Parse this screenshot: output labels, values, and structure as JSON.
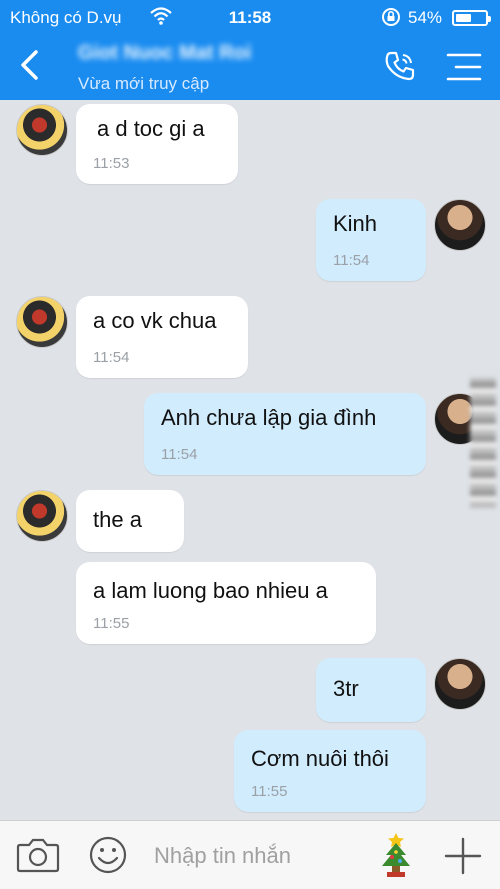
{
  "status_bar": {
    "carrier": "Không có D.vụ",
    "time": "11:58",
    "battery_percent": "54%",
    "battery_level": 0.54
  },
  "header": {
    "contact_name": "Giot Nuoc Mat Roi",
    "contact_status": "Vừa mới truy cập",
    "accent_color": "#1a8cf0"
  },
  "messages": [
    {
      "side": "in",
      "text": "a d toc gi a",
      "time": "11:53"
    },
    {
      "side": "out",
      "text": "Kinh",
      "time": "11:54"
    },
    {
      "side": "in",
      "text": "a co vk chua",
      "time": "11:54"
    },
    {
      "side": "out",
      "text": "Anh chưa lập gia đình",
      "time": "11:54"
    },
    {
      "side": "in",
      "text": "the a",
      "time": ""
    },
    {
      "side": "in",
      "text": "a lam luong bao nhieu a",
      "time": "11:55"
    },
    {
      "side": "out",
      "text": "3tr",
      "time": ""
    },
    {
      "side": "out",
      "text": "Cơm nuôi thôi",
      "time": "11:55"
    }
  ],
  "composer": {
    "placeholder": "Nhập tin nhắn"
  },
  "icons": [
    "back-icon",
    "phone-icon",
    "menu-icon",
    "camera-icon",
    "smiley-icon",
    "christmas-tree-icon",
    "plus-icon"
  ]
}
